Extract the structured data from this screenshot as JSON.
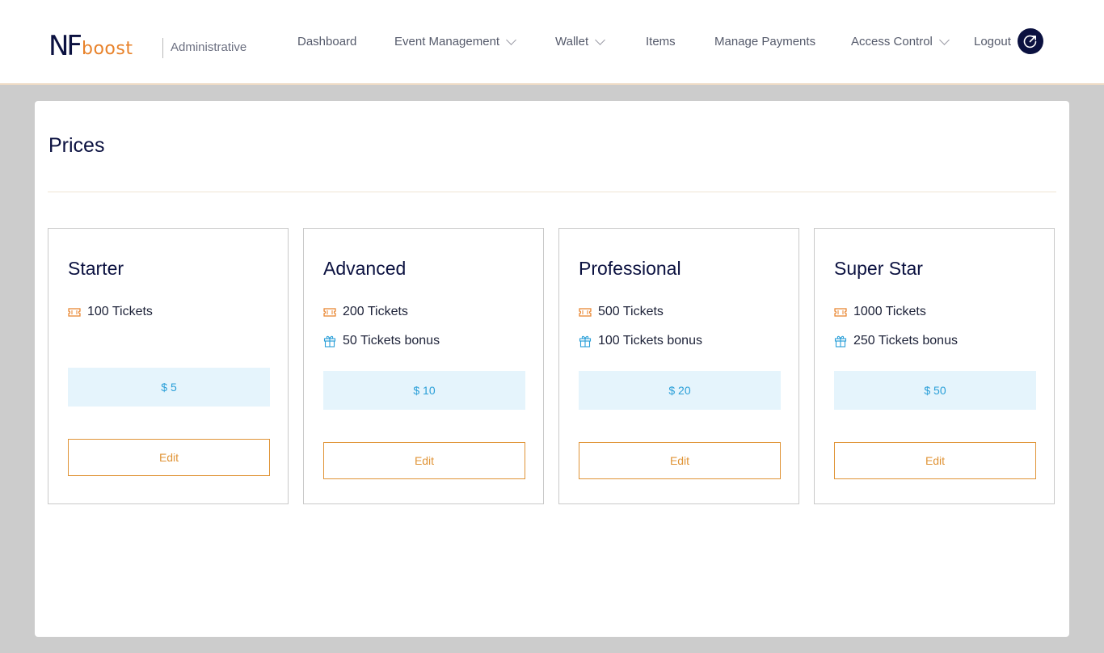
{
  "header": {
    "logo": {
      "nf": "NF",
      "boost": "boost"
    },
    "admin_label": "Administrative",
    "nav": [
      {
        "label": "Dashboard"
      },
      {
        "label": "Event Management",
        "dropdown": true
      },
      {
        "label": "Wallet",
        "dropdown": true
      },
      {
        "label": "Items"
      },
      {
        "label": "Manage Payments"
      },
      {
        "label": "Access Control",
        "dropdown": true
      },
      {
        "label": "Logout"
      }
    ]
  },
  "page": {
    "title": "Prices"
  },
  "plans": [
    {
      "name": "Starter",
      "tickets": "100 Tickets",
      "bonus": "",
      "price": "$ 5",
      "edit": "Edit"
    },
    {
      "name": "Advanced",
      "tickets": "200 Tickets",
      "bonus": "50 Tickets bonus",
      "price": "$ 10",
      "edit": "Edit"
    },
    {
      "name": "Professional",
      "tickets": "500 Tickets",
      "bonus": "100 Tickets bonus",
      "price": "$ 20",
      "edit": "Edit"
    },
    {
      "name": "Super Star",
      "tickets": "1000 Tickets",
      "bonus": "250 Tickets bonus",
      "price": "$ 50",
      "edit": "Edit"
    }
  ],
  "icons": {
    "ticket": "ticket-icon",
    "bonus": "gift-icon",
    "logout": "logout-icon",
    "chevron": "chevron-down-icon"
  },
  "colors": {
    "brand_dark": "#0b1140",
    "brand_orange": "#e8822a",
    "price_bg": "#e5f4fc",
    "price_text": "#2a9fd8",
    "edit_border": "#e09437"
  }
}
